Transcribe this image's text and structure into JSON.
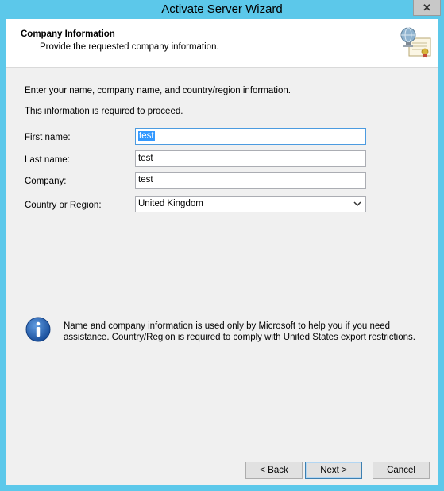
{
  "window": {
    "title": "Activate Server Wizard",
    "close_glyph": "✕"
  },
  "header": {
    "title": "Company Information",
    "subtitle": "Provide the requested company information.",
    "icon": "certificate-globe-icon"
  },
  "body": {
    "intro": "Enter your name, company name, and country/region information.",
    "required_note": "This information is required to proceed.",
    "fields": {
      "first_name": {
        "label": "First name:",
        "value": "test"
      },
      "last_name": {
        "label": "Last name:",
        "value": "test"
      },
      "company": {
        "label": "Company:",
        "value": "test"
      },
      "country": {
        "label": "Country or Region:",
        "value": "United Kingdom"
      }
    },
    "info_text_line1": "Name and company information is used only by Microsoft to help you if you need",
    "info_text_line2": "assistance. Country/Region is required to comply with United States export restrictions.",
    "info_icon": "info-icon"
  },
  "buttons": {
    "back": "< Back",
    "next": "Next >",
    "cancel": "Cancel"
  },
  "colors": {
    "frame": "#5cc8ea",
    "client_bg": "#f0f0f0",
    "selection": "#3399ff",
    "info_blue": "#1e5fb4"
  }
}
